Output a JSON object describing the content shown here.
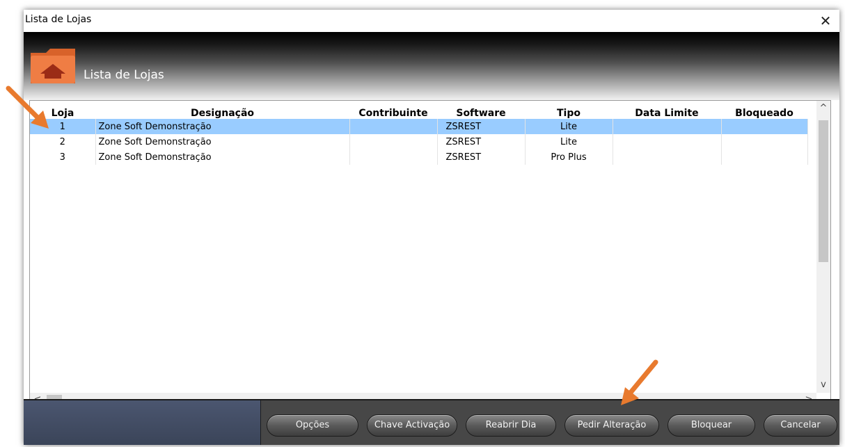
{
  "window": {
    "title": "Lista de Lojas",
    "close_symbol": "✕"
  },
  "header": {
    "icon": "folder-home-icon",
    "title": "Lista de Lojas"
  },
  "table": {
    "columns": [
      "Loja",
      "Designação",
      "Contribuinte",
      "Software",
      "Tipo",
      "Data Limite",
      "Bloqueado"
    ],
    "rows": [
      {
        "loja": "1",
        "designacao": "Zone Soft Demonstração",
        "contribuinte": "",
        "software": "ZSREST",
        "tipo": "Lite",
        "data_limite": "",
        "bloqueado": "",
        "selected": true
      },
      {
        "loja": "2",
        "designacao": "Zone Soft Demonstração",
        "contribuinte": "",
        "software": "ZSREST",
        "tipo": "Lite",
        "data_limite": "",
        "bloqueado": "",
        "selected": false
      },
      {
        "loja": "3",
        "designacao": "Zone Soft Demonstração",
        "contribuinte": "",
        "software": "ZSREST",
        "tipo": "Pro Plus",
        "data_limite": "",
        "bloqueado": "",
        "selected": false
      }
    ]
  },
  "scrollbars": {
    "up": "^",
    "down": "v",
    "left": "<",
    "right": ">"
  },
  "buttons": {
    "opcoes": "Opções",
    "chave_activacao": "Chave Activação",
    "reabrir_dia": "Reabrir Dia",
    "pedir_alteracao": "Pedir Alteração",
    "bloquear": "Bloquear",
    "cancelar": "Cancelar"
  },
  "colors": {
    "selection": "#99ccff",
    "folder_orange": "#e8733a",
    "annotation_arrow": "#e87a2e"
  }
}
